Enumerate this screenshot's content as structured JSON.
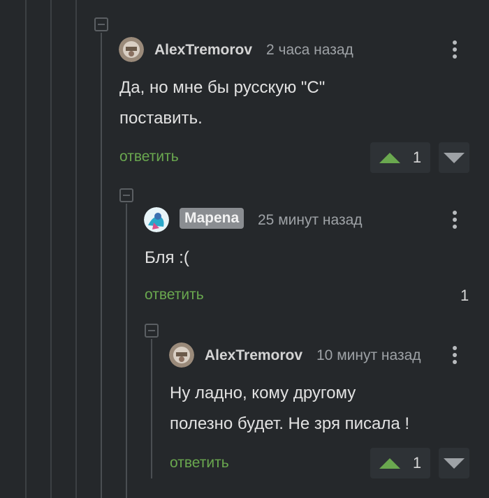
{
  "comments": [
    {
      "author": "AlexTremorov",
      "time": "2 часа назад",
      "text_lines": [
        "Да, но мне бы русскую \"С\"",
        "поставить."
      ],
      "reply_label": "ответить",
      "rating": "1",
      "avatar_icon": "photo-avatar-icon"
    },
    {
      "author": "Mapena",
      "time": "25 минут назад",
      "text_lines": [
        "Бля :("
      ],
      "reply_label": "ответить",
      "rating": "1",
      "avatar_icon": "photo-avatar-icon"
    },
    {
      "author": "AlexTremorov",
      "time": "10 минут назад",
      "text_lines": [
        "Ну ладно, кому другому",
        "полезно будет. Не зря писала !"
      ],
      "reply_label": "ответить",
      "rating": "1",
      "avatar_icon": "photo-avatar-icon"
    }
  ],
  "colors": {
    "background": "#25282b",
    "reply_link": "#6aa84f",
    "upvote": "#6aa84f",
    "badge_bg": "#8a8d91"
  }
}
